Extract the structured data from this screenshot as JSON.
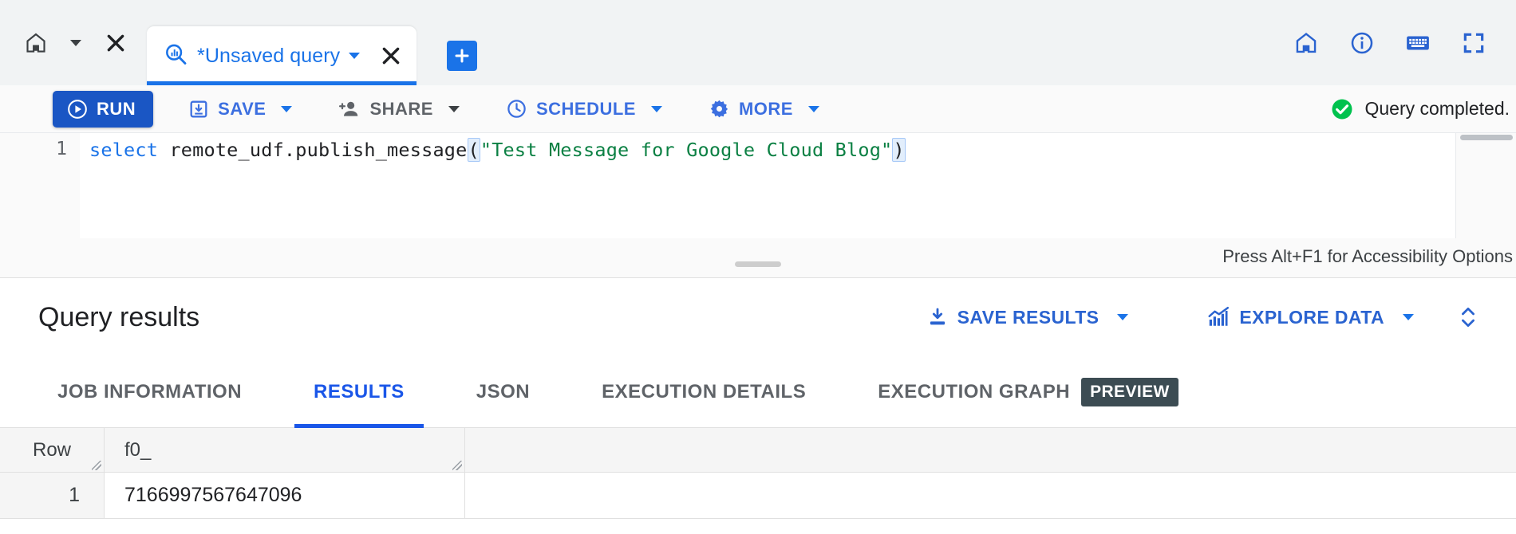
{
  "tabbar": {
    "home_icon": "home-icon",
    "home_caret_icon": "chevron-down-icon",
    "close_all_icon": "close-icon",
    "query_tab": {
      "icon": "query-search-icon",
      "title": "*Unsaved query",
      "caret_icon": "chevron-down-icon",
      "close_icon": "close-icon"
    },
    "new_tab_icon": "plus-icon",
    "right_icons": [
      "home-icon",
      "info-icon",
      "keyboard-icon",
      "fullscreen-icon"
    ]
  },
  "toolbar": {
    "run_label": "RUN",
    "run_icon": "play-circle-icon",
    "items": [
      {
        "label": "SAVE",
        "icon": "save-download-icon",
        "caret": true
      },
      {
        "label": "SHARE",
        "icon": "person-add-icon",
        "caret": true
      },
      {
        "label": "SCHEDULE",
        "icon": "clock-icon",
        "caret": true
      },
      {
        "label": "MORE",
        "icon": "gear-icon",
        "caret": true
      }
    ],
    "status_text": "Query completed.",
    "status_icon": "check-circle-icon",
    "status_color": "#00c24e"
  },
  "editor": {
    "line_number": "1",
    "code": {
      "keyword": "select",
      "fn": " remote_udf.publish_message",
      "open_paren": "(",
      "string": "\"Test Message for Google Cloud Blog\"",
      "close_paren": ")"
    }
  },
  "divider": {
    "accessibility_hint": "Press Alt+F1 for Accessibility Options",
    "grabber": "resize-handle"
  },
  "results": {
    "title": "Query results",
    "actions": [
      {
        "label": "SAVE RESULTS",
        "icon": "download-icon",
        "caret": true
      },
      {
        "label": "EXPLORE DATA",
        "icon": "chart-icon",
        "caret": true
      }
    ],
    "expander_icon": "expand-collapse-icon",
    "tabs": [
      {
        "label": "JOB INFORMATION",
        "active": false
      },
      {
        "label": "RESULTS",
        "active": true
      },
      {
        "label": "JSON",
        "active": false
      },
      {
        "label": "EXECUTION DETAILS",
        "active": false
      },
      {
        "label": "EXECUTION GRAPH",
        "active": false,
        "badge": "PREVIEW"
      }
    ],
    "table": {
      "columns": [
        "Row",
        "f0_"
      ],
      "rows": [
        {
          "row": "1",
          "f0_": "7166997567647096"
        }
      ]
    }
  },
  "colors": {
    "accent_blue": "#1a73e8",
    "run_blue": "#1a56c4",
    "success_green": "#00c24e",
    "badge_bg": "#3c4c53"
  }
}
